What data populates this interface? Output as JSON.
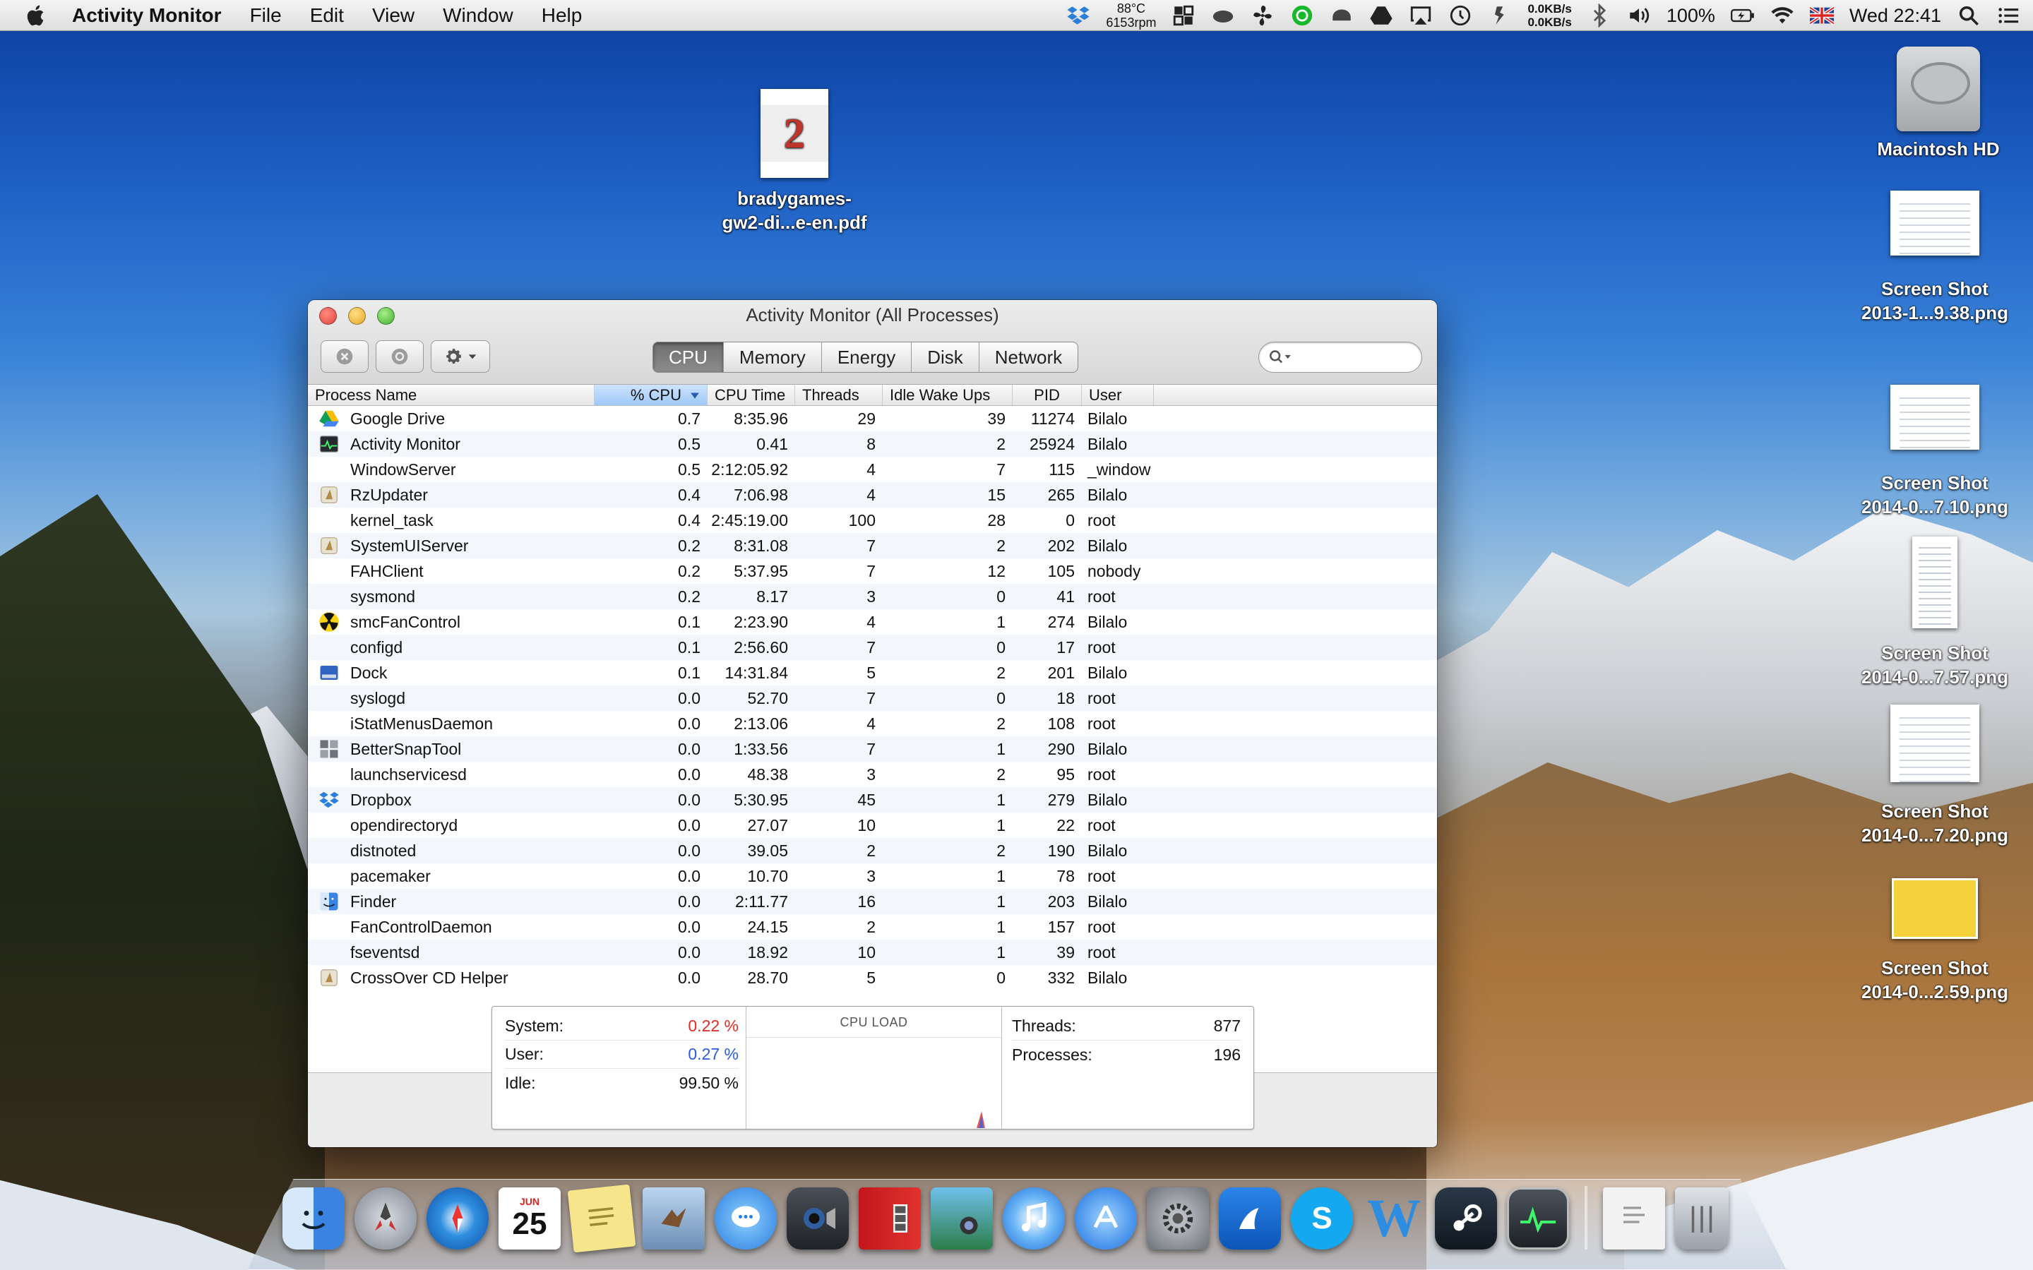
{
  "menubar": {
    "app": "Activity Monitor",
    "menus": [
      "File",
      "Edit",
      "View",
      "Window",
      "Help"
    ],
    "temp": "88°C",
    "rpm": "6153rpm",
    "net_up": "0.0KB/s",
    "net_down": "0.0KB/s",
    "battery": "100%",
    "clock": "Wed 22:41"
  },
  "desktop": {
    "pdf": "bradygames-\ngw2-di...e-en.pdf",
    "pdf_cover_text": "2",
    "hd": "Macintosh HD",
    "shot1": "Screen Shot\n2013-1...9.38.png",
    "shot2": "Screen Shot\n2014-0...7.10.png",
    "shot3": "Screen Shot\n2014-0...7.57.png",
    "shot4": "Screen Shot\n2014-0...7.20.png",
    "shot5": "Screen Shot\n2014-0...2.59.png"
  },
  "window": {
    "title": "Activity Monitor (All Processes)",
    "tabs": [
      "CPU",
      "Memory",
      "Energy",
      "Disk",
      "Network"
    ],
    "active_tab": "CPU",
    "search_placeholder": ""
  },
  "table": {
    "columns": [
      "Process Name",
      "% CPU",
      "CPU Time",
      "Threads",
      "Idle Wake Ups",
      "PID",
      "User"
    ],
    "sort_column": "% CPU",
    "rows": [
      {
        "icon": "google-drive-icon",
        "name": "Google Drive",
        "cpu": "0.7",
        "time": "8:35.96",
        "threads": "29",
        "wake": "39",
        "pid": "11274",
        "user": "Bilalo"
      },
      {
        "icon": "activity-monitor-icon",
        "name": "Activity Monitor",
        "cpu": "0.5",
        "time": "0.41",
        "threads": "8",
        "wake": "2",
        "pid": "25924",
        "user": "Bilalo"
      },
      {
        "icon": "",
        "name": "WindowServer",
        "cpu": "0.5",
        "time": "2:12:05.92",
        "threads": "4",
        "wake": "7",
        "pid": "115",
        "user": "_window"
      },
      {
        "icon": "app-generic-icon",
        "name": "RzUpdater",
        "cpu": "0.4",
        "time": "7:06.98",
        "threads": "4",
        "wake": "15",
        "pid": "265",
        "user": "Bilalo"
      },
      {
        "icon": "",
        "name": "kernel_task",
        "cpu": "0.4",
        "time": "2:45:19.00",
        "threads": "100",
        "wake": "28",
        "pid": "0",
        "user": "root"
      },
      {
        "icon": "app-generic-icon",
        "name": "SystemUIServer",
        "cpu": "0.2",
        "time": "8:31.08",
        "threads": "7",
        "wake": "2",
        "pid": "202",
        "user": "Bilalo"
      },
      {
        "icon": "",
        "name": "FAHClient",
        "cpu": "0.2",
        "time": "5:37.95",
        "threads": "7",
        "wake": "12",
        "pid": "105",
        "user": "nobody"
      },
      {
        "icon": "",
        "name": "sysmond",
        "cpu": "0.2",
        "time": "8.17",
        "threads": "3",
        "wake": "0",
        "pid": "41",
        "user": "root"
      },
      {
        "icon": "radiation-icon",
        "name": "smcFanControl",
        "cpu": "0.1",
        "time": "2:23.90",
        "threads": "4",
        "wake": "1",
        "pid": "274",
        "user": "Bilalo"
      },
      {
        "icon": "",
        "name": "configd",
        "cpu": "0.1",
        "time": "2:56.60",
        "threads": "7",
        "wake": "0",
        "pid": "17",
        "user": "root"
      },
      {
        "icon": "dock-icon",
        "name": "Dock",
        "cpu": "0.1",
        "time": "14:31.84",
        "threads": "5",
        "wake": "2",
        "pid": "201",
        "user": "Bilalo"
      },
      {
        "icon": "",
        "name": "syslogd",
        "cpu": "0.0",
        "time": "52.70",
        "threads": "7",
        "wake": "0",
        "pid": "18",
        "user": "root"
      },
      {
        "icon": "",
        "name": "iStatMenusDaemon",
        "cpu": "0.0",
        "time": "2:13.06",
        "threads": "4",
        "wake": "2",
        "pid": "108",
        "user": "root"
      },
      {
        "icon": "grid-app-icon",
        "name": "BetterSnapTool",
        "cpu": "0.0",
        "time": "1:33.56",
        "threads": "7",
        "wake": "1",
        "pid": "290",
        "user": "Bilalo"
      },
      {
        "icon": "",
        "name": "launchservicesd",
        "cpu": "0.0",
        "time": "48.38",
        "threads": "3",
        "wake": "2",
        "pid": "95",
        "user": "root"
      },
      {
        "icon": "dropbox-icon",
        "name": "Dropbox",
        "cpu": "0.0",
        "time": "5:30.95",
        "threads": "45",
        "wake": "1",
        "pid": "279",
        "user": "Bilalo"
      },
      {
        "icon": "",
        "name": "opendirectoryd",
        "cpu": "0.0",
        "time": "27.07",
        "threads": "10",
        "wake": "1",
        "pid": "22",
        "user": "root"
      },
      {
        "icon": "",
        "name": "distnoted",
        "cpu": "0.0",
        "time": "39.05",
        "threads": "2",
        "wake": "2",
        "pid": "190",
        "user": "Bilalo"
      },
      {
        "icon": "",
        "name": "pacemaker",
        "cpu": "0.0",
        "time": "10.70",
        "threads": "3",
        "wake": "1",
        "pid": "78",
        "user": "root"
      },
      {
        "icon": "finder-icon",
        "name": "Finder",
        "cpu": "0.0",
        "time": "2:11.77",
        "threads": "16",
        "wake": "1",
        "pid": "203",
        "user": "Bilalo"
      },
      {
        "icon": "",
        "name": "FanControlDaemon",
        "cpu": "0.0",
        "time": "24.15",
        "threads": "2",
        "wake": "1",
        "pid": "157",
        "user": "root"
      },
      {
        "icon": "",
        "name": "fseventsd",
        "cpu": "0.0",
        "time": "18.92",
        "threads": "10",
        "wake": "1",
        "pid": "39",
        "user": "root"
      },
      {
        "icon": "app-generic-icon",
        "name": "CrossOver CD Helper",
        "cpu": "0.0",
        "time": "28.70",
        "threads": "5",
        "wake": "0",
        "pid": "332",
        "user": "Bilalo"
      }
    ]
  },
  "stats": {
    "system_label": "System:",
    "system_value": "0.22 %",
    "user_label": "User:",
    "user_value": "0.27 %",
    "idle_label": "Idle:",
    "idle_value": "99.50 %",
    "cpu_load_label": "CPU LOAD",
    "threads_label": "Threads:",
    "threads_value": "877",
    "processes_label": "Processes:",
    "processes_value": "196"
  },
  "dock": {
    "items": [
      "finder-icon",
      "launchpad-icon",
      "safari-icon",
      "calendar-icon",
      "stickies-icon",
      "mail-icon",
      "messages-icon",
      "facetime-icon",
      "photo-booth-icon",
      "iphoto-icon",
      "itunes-icon",
      "app-store-icon",
      "system-preferences-icon",
      "pushbullet-icon",
      "skype-icon",
      "word-icon",
      "steam-icon",
      "activity-monitor-icon",
      "documents-icon",
      "trash-icon"
    ],
    "calendar_month": "JUN",
    "calendar_day": "25",
    "skype_letter": "S",
    "word_letter": "W"
  }
}
